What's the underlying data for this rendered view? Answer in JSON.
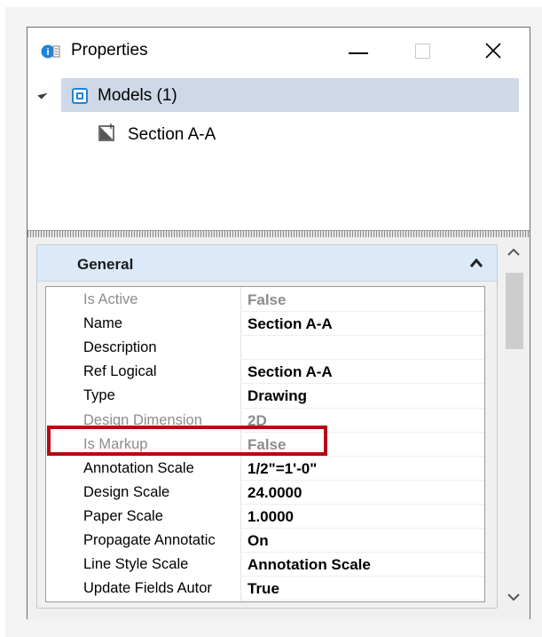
{
  "window": {
    "title": "Properties",
    "icons": {
      "app": "properties-icon",
      "minimize": "minimize-icon",
      "maximize": "maximize-icon",
      "close": "close-icon"
    }
  },
  "tree": {
    "root": {
      "label": "Models (1)",
      "icon": "models-icon",
      "expanded": true
    },
    "children": [
      {
        "label": "Section A-A",
        "icon": "drawing-model-icon"
      }
    ]
  },
  "properties": {
    "group_title": "General",
    "rows": [
      {
        "name": "Is Active",
        "value": "False",
        "disabled": true
      },
      {
        "name": "Name",
        "value": "Section A-A",
        "disabled": false
      },
      {
        "name": "Description",
        "value": "",
        "disabled": false
      },
      {
        "name": "Ref Logical",
        "value": "Section A-A",
        "disabled": false
      },
      {
        "name": "Type",
        "value": "Drawing",
        "disabled": false
      },
      {
        "name": "Design Dimension",
        "value": "2D",
        "disabled": true
      },
      {
        "name": "Is Markup",
        "value": "False",
        "disabled": true
      },
      {
        "name": "Annotation Scale",
        "value": "1/2\"=1'-0\"",
        "disabled": false
      },
      {
        "name": "Design Scale",
        "value": "24.0000",
        "disabled": false
      },
      {
        "name": "Paper Scale",
        "value": "1.0000",
        "disabled": false
      },
      {
        "name": "Propagate Annotatic",
        "value": "On",
        "disabled": false
      },
      {
        "name": "Line Style Scale",
        "value": "Annotation Scale",
        "disabled": false
      },
      {
        "name": "Update Fields Autor",
        "value": "True",
        "disabled": false
      }
    ]
  },
  "colors": {
    "highlight": "#b40b16",
    "selection": "#cfd8e6",
    "group_header": "#dbe9f8",
    "accent": "#1f84d8"
  }
}
